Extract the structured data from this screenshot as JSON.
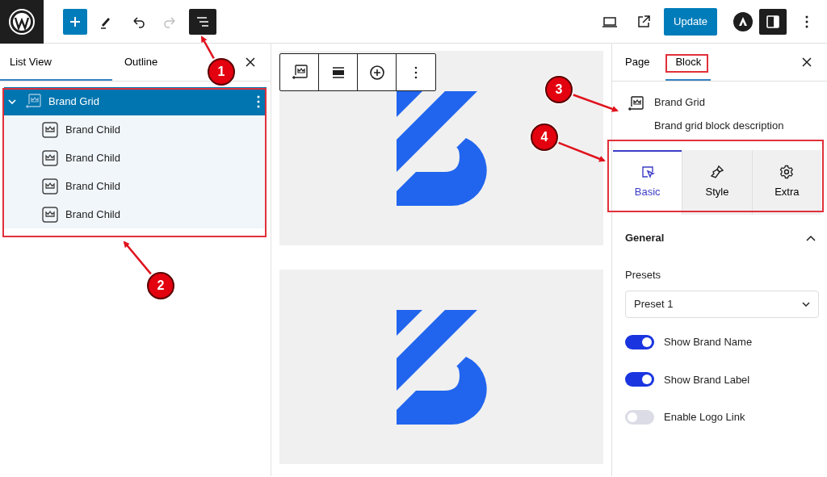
{
  "toolbar": {
    "undo_enabled": true,
    "redo_enabled": false,
    "list_view_active": true,
    "settings_active": true,
    "primary_button": "Update"
  },
  "list_panel": {
    "tabs": [
      {
        "label": "List View",
        "selected": true
      },
      {
        "label": "Outline",
        "selected": false
      }
    ],
    "tree": [
      {
        "label": "Brand Grid",
        "selected": true,
        "expanded": true,
        "children": [
          {
            "label": "Brand Child",
            "selected": false
          },
          {
            "label": "Brand Child",
            "selected": false
          },
          {
            "label": "Brand Child",
            "selected": false
          },
          {
            "label": "Brand Child",
            "selected": false
          }
        ]
      }
    ]
  },
  "sidebar": {
    "tabs": [
      {
        "label": "Page",
        "selected": false
      },
      {
        "label": "Block",
        "selected": true
      }
    ],
    "block": {
      "title": "Brand Grid",
      "description": "Brand grid block description"
    },
    "setting_tabs": [
      {
        "label": "Basic",
        "kind": "basic",
        "selected": true
      },
      {
        "label": "Style",
        "kind": "style",
        "selected": false
      },
      {
        "label": "Extra",
        "kind": "extra",
        "selected": false
      }
    ],
    "section": {
      "title": "General",
      "expanded": true
    },
    "presets": {
      "label": "Presets",
      "value": "Preset 1"
    },
    "toggles": [
      {
        "label": "Show Brand Name",
        "on": true
      },
      {
        "label": "Show Brand Label",
        "on": true
      },
      {
        "label": "Enable Logo Link",
        "on": false
      }
    ]
  },
  "annotations": [
    {
      "label": "1"
    },
    {
      "label": "2"
    },
    {
      "label": "3"
    },
    {
      "label": "4"
    }
  ]
}
